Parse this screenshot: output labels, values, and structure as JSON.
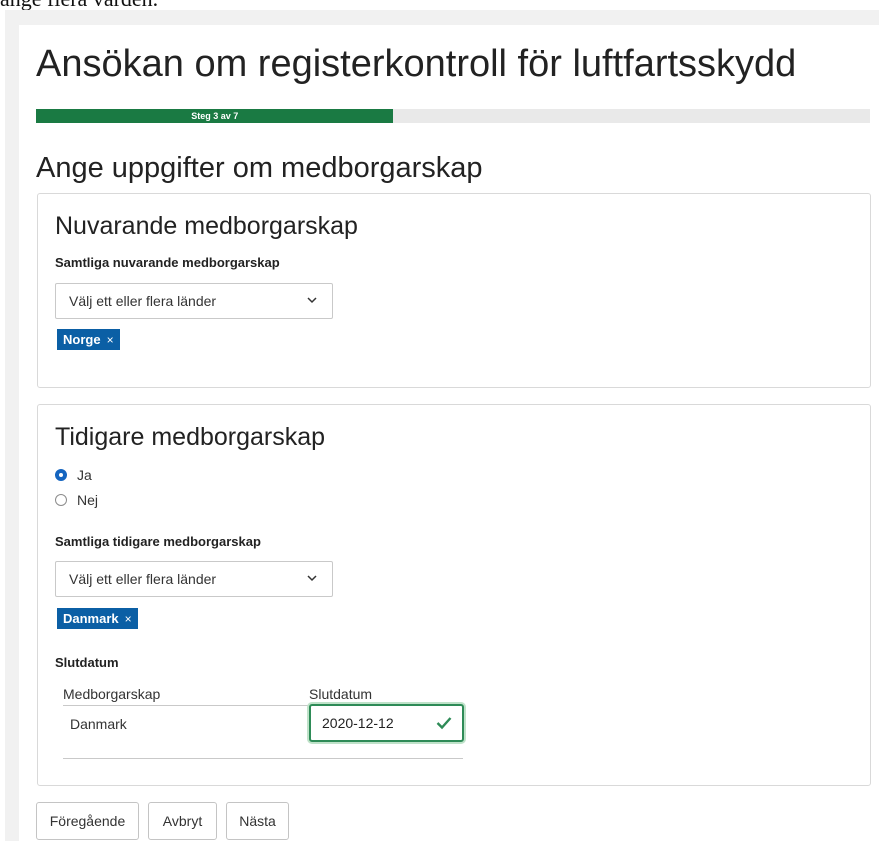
{
  "top_cut_text": "ange flera värden.",
  "page_title": "Ansökan om registerkontroll för luftfartsskydd",
  "progress": {
    "label": "Steg 3 av 7",
    "current_step": 3,
    "total_steps": 7,
    "fill_color": "#1a7a43"
  },
  "section_title": "Ange uppgifter om medborgarskap",
  "current_citizenship": {
    "heading": "Nuvarande medborgarskap",
    "field_label": "Samtliga nuvarande medborgarskap",
    "select_placeholder": "Välj ett eller flera länder",
    "tags": [
      {
        "label": "Norge",
        "remove": "×"
      }
    ]
  },
  "previous_citizenship": {
    "heading": "Tidigare medborgarskap",
    "options": [
      {
        "label": "Ja",
        "checked": true
      },
      {
        "label": "Nej",
        "checked": false
      }
    ],
    "field_label": "Samtliga tidigare medborgarskap",
    "select_placeholder": "Välj ett eller flera länder",
    "tags": [
      {
        "label": "Danmark",
        "remove": "×"
      }
    ],
    "end_date_label": "Slutdatum",
    "table": {
      "columns": [
        "Medborgarskap",
        "Slutdatum"
      ],
      "rows": [
        {
          "country": "Danmark",
          "end_date": "2020-12-12"
        }
      ]
    }
  },
  "buttons": {
    "previous": "Föregående",
    "cancel": "Avbryt",
    "next": "Nästa"
  },
  "colors": {
    "tag_bg": "#0b5fa5",
    "radio_checked": "#1565c0",
    "valid_border": "#2e8b57"
  }
}
